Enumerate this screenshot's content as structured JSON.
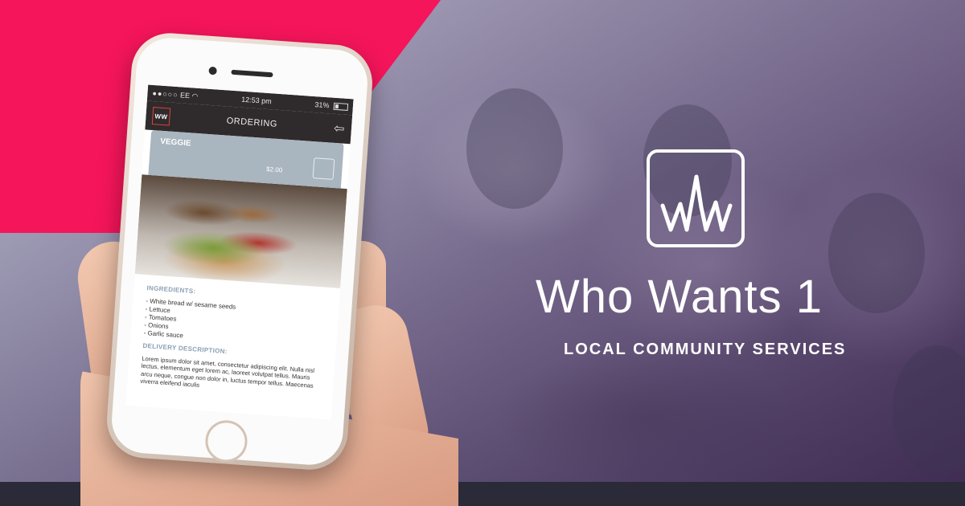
{
  "colors": {
    "accent_pink": "#f5155a",
    "header_dark": "#2f2a2b",
    "card_blue_grey": "#a9b5bf",
    "section_title": "#8aa0b4"
  },
  "phone": {
    "status": {
      "signal": "●●○○○",
      "carrier": "EE",
      "time": "12:53 pm",
      "battery": "31%"
    },
    "appbar": {
      "logo": "WW",
      "title": "ORDERING",
      "back_icon": "back-arrow-icon"
    },
    "item": {
      "name": "VEGGIE",
      "price": "$2.00"
    },
    "ingredients_title": "INGREDIENTS:",
    "ingredients": [
      "- White bread w/ sesame seeds",
      "- Lettuce",
      "- Tomatoes",
      "- Onions",
      "- Garlic sauce"
    ],
    "delivery_title": "DELIVERY DESCRIPTION:",
    "delivery_text": "Lorem ipsum dolor sit amet, consectetur adipiscing elit. Nulla nisl lectus, elementum eget lorem ac, laoreet volutpat tellus. Mauris arcu neque, congue non dolor in, luctus tempor tellus. Maecenas viverra eleifend iaculis"
  },
  "brand": {
    "logo_icon": "ww-logo-icon",
    "title": "Who Wants 1",
    "subtitle": "LOCAL COMMUNITY SERVICES"
  }
}
